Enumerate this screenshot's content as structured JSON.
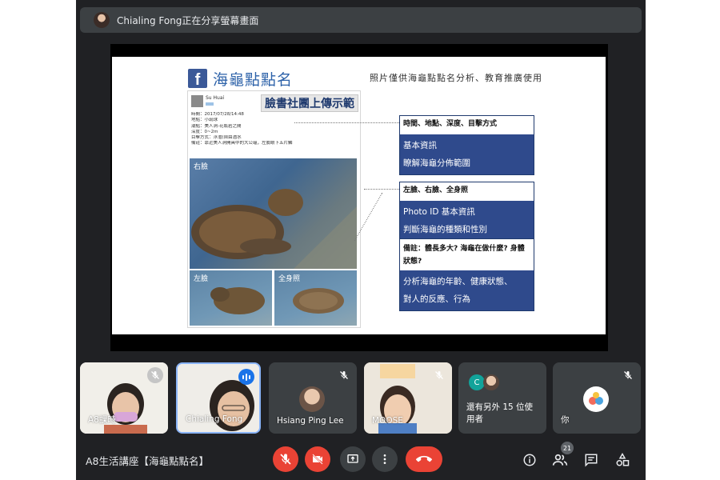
{
  "banner": {
    "text": "Chialing Fong正在分享螢幕畫面"
  },
  "slide": {
    "title": "海龜點點名",
    "note": "照片僅供海龜點點名分析、教育推廣使用",
    "post": {
      "name": "Su Huai",
      "label": "臉書社團上傳示範",
      "details": [
        "時間：2017/07/28/14:48",
        "地點：小琉球",
        "潮點：美人洞-花瓶岩之間",
        "深度：0~2m",
        "目擊方式：浮潛(自由潛水",
        "備註：靠近美人洞開具中的大公龜，左臉眼下五片鱗"
      ],
      "photos": {
        "right": "右臉",
        "left": "左臉",
        "full": "全身照"
      }
    },
    "boxes": [
      {
        "header": "時間、地點、深度、目擊方式",
        "lines": [
          "基本資訊",
          "瞭解海龜分佈範圍"
        ]
      },
      {
        "header": "左臉、右臉、全身照",
        "lines": [
          "Photo ID 基本資訊",
          "判斷海龜的種類和性別"
        ]
      },
      {
        "header": "備註：體長多大? 海龜在做什麼? 身體狀態?",
        "lines": [
          "分析海龜的年齡、健康狀態、",
          "對人的反應、行為"
        ]
      }
    ]
  },
  "participants": [
    {
      "name": "A8課時",
      "mic": "off"
    },
    {
      "name": "Chialing Fong",
      "mic": "speaking"
    },
    {
      "name": "Hsiang Ping Lee",
      "mic": "off"
    },
    {
      "name": "MOOSE",
      "mic": "off"
    },
    {
      "name": "還有另外 15 位使用者",
      "avatar_letter": "C"
    },
    {
      "name": "你",
      "mic": "off"
    }
  ],
  "bottom": {
    "meeting_title": "A8生活講座【海龜點點名】",
    "people_count": "21"
  },
  "colors": {
    "background": "#202124",
    "tile": "#3c4043",
    "danger": "#ea4335",
    "speaking": "#1a73e8",
    "slide_accent": "#2f4a8c"
  }
}
